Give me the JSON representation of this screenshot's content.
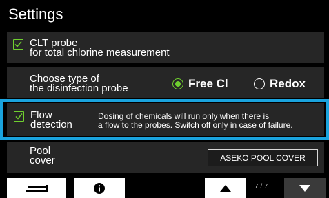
{
  "header": {
    "title": "Settings"
  },
  "settings": {
    "clt_probe": {
      "line1": "CLT probe",
      "line2": "for total chlorine measurement",
      "checked": true
    },
    "disinfection_probe": {
      "line1": "Choose type of",
      "line2": "the disinfection probe",
      "options": [
        "Free Cl",
        "Redox"
      ],
      "selected": "Free Cl"
    },
    "flow_detection": {
      "line1": "Flow",
      "line2": "detection",
      "desc1": "Dosing of chemicals will run only when there is",
      "desc2": "a flow to the probes. Switch off only in case of failure.",
      "checked": true
    },
    "pool_cover": {
      "line1": "Pool",
      "line2": "cover",
      "button_label": "ASEKO POOL COVER"
    }
  },
  "footer": {
    "page_indicator": "7 / 7"
  },
  "colors": {
    "accent_green": "#6fcf2f",
    "highlight_blue": "#1aa3dd",
    "panel": "#262626"
  },
  "icons": {
    "back": "return-arrow-icon",
    "info": "info-icon",
    "up": "triangle-up-icon",
    "down": "triangle-down-icon"
  }
}
